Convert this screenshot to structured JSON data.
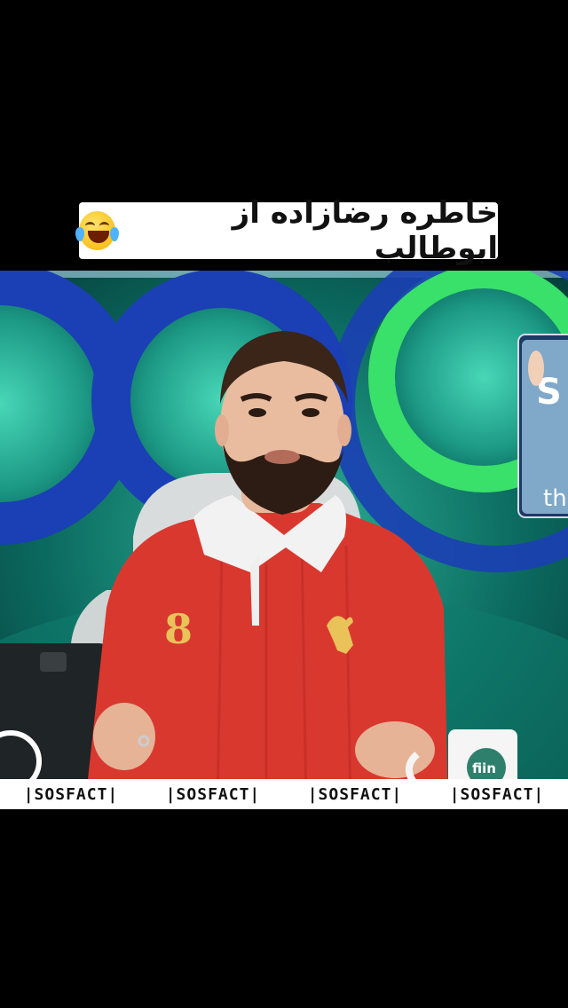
{
  "caption": {
    "text": "خاطره رضازاده از ابوطالب",
    "emoji_icon": "face-with-tears-of-joy-icon"
  },
  "video": {
    "jersey_number": "8",
    "mug_text": "fiin",
    "side_screen_text": "S",
    "side_screen_text2": "th"
  },
  "ticker": {
    "items": [
      "|SOSFACT|",
      "|SOSFACT|",
      "|SOSFACT|",
      "|SOSFACT|"
    ]
  },
  "colors": {
    "background": "#000000",
    "studio_teal": "#0b6a5f",
    "ring_blue": "#1b3fb4",
    "ring_green": "#39e06a",
    "jersey_red": "#d9382f",
    "collar_white": "#f2f2f2"
  }
}
